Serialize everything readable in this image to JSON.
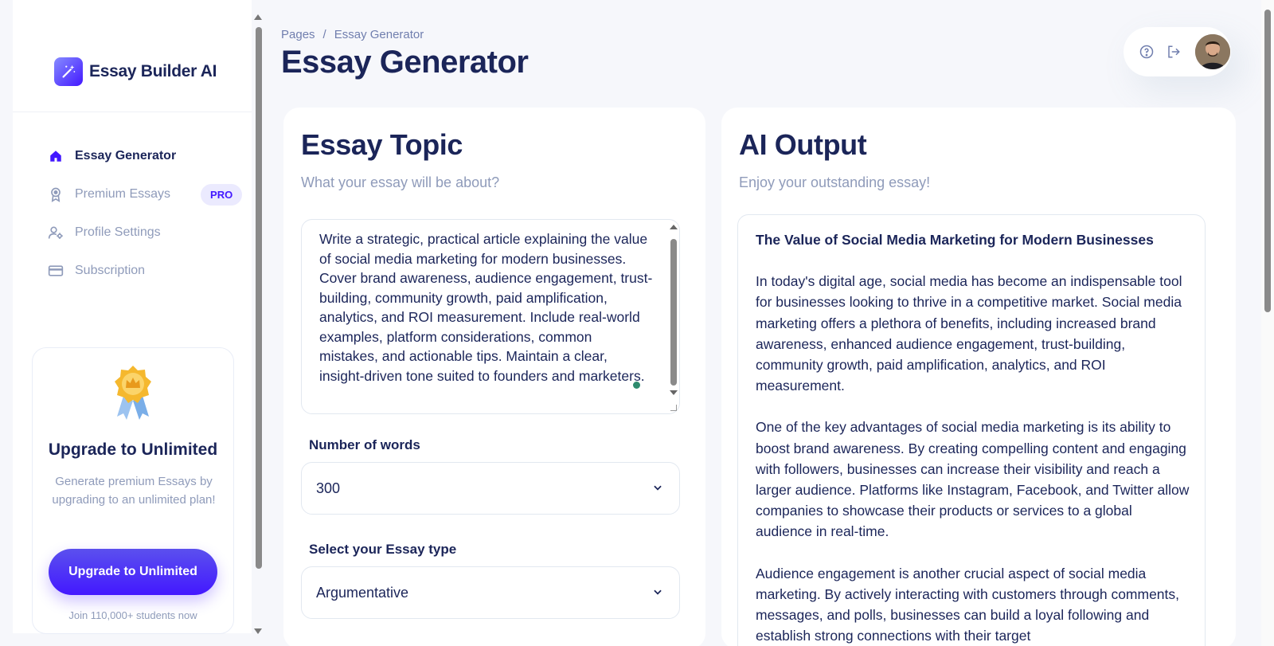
{
  "sidebar": {
    "brand": "Essay Builder AI",
    "nav": [
      {
        "label": "Essay Generator",
        "icon": "home-icon",
        "active": true
      },
      {
        "label": "Premium Essays",
        "icon": "award-icon",
        "badge": "PRO"
      },
      {
        "label": "Profile Settings",
        "icon": "user-settings-icon"
      },
      {
        "label": "Subscription",
        "icon": "credit-card-icon"
      }
    ],
    "upgrade": {
      "title": "Upgrade to Unlimited",
      "description": "Generate premium Essays by upgrading to an unlimited plan!",
      "button": "Upgrade to Unlimited",
      "note": "Join 110,000+ students now"
    }
  },
  "header": {
    "breadcrumb_root": "Pages",
    "breadcrumb_sep": "/",
    "breadcrumb_current": "Essay Generator",
    "title": "Essay Generator"
  },
  "topic_card": {
    "title": "Essay Topic",
    "subtitle": "What your essay will be about?",
    "topic_text": "Write a strategic, practical article explaining the value of social media marketing for modern businesses. Cover brand awareness, audience engagement, trust-building, community growth, paid amplification, analytics, and ROI measurement. Include real-world examples, platform considerations, common mistakes, and actionable tips. Maintain a clear, insight-driven tone suited to founders and marketers.",
    "words_label": "Number of words",
    "words_value": "300",
    "type_label": "Select your Essay type",
    "type_value": "Argumentative"
  },
  "output_card": {
    "title": "AI Output",
    "subtitle": "Enjoy your outstanding essay!",
    "heading": "The Value of Social Media Marketing for Modern Businesses",
    "paragraphs": [
      "In today's digital age, social media has become an indispensable tool for businesses looking to thrive in a competitive market. Social media marketing offers a plethora of benefits, including increased brand awareness, enhanced audience engagement, trust-building, community growth, paid amplification, analytics, and ROI measurement.",
      "One of the key advantages of social media marketing is its ability to boost brand awareness. By creating compelling content and engaging with followers, businesses can increase their visibility and reach a larger audience. Platforms like Instagram, Facebook, and Twitter allow companies to showcase their products or services to a global audience in real-time.",
      "Audience engagement is another crucial aspect of social media marketing. By actively interacting with customers through comments, messages, and polls, businesses can build a loyal following and establish strong connections with their target"
    ]
  },
  "colors": {
    "brand": "#4318ff",
    "text_primary": "#1b2559",
    "text_secondary": "#8f9bba",
    "background": "#f6f7fb"
  }
}
